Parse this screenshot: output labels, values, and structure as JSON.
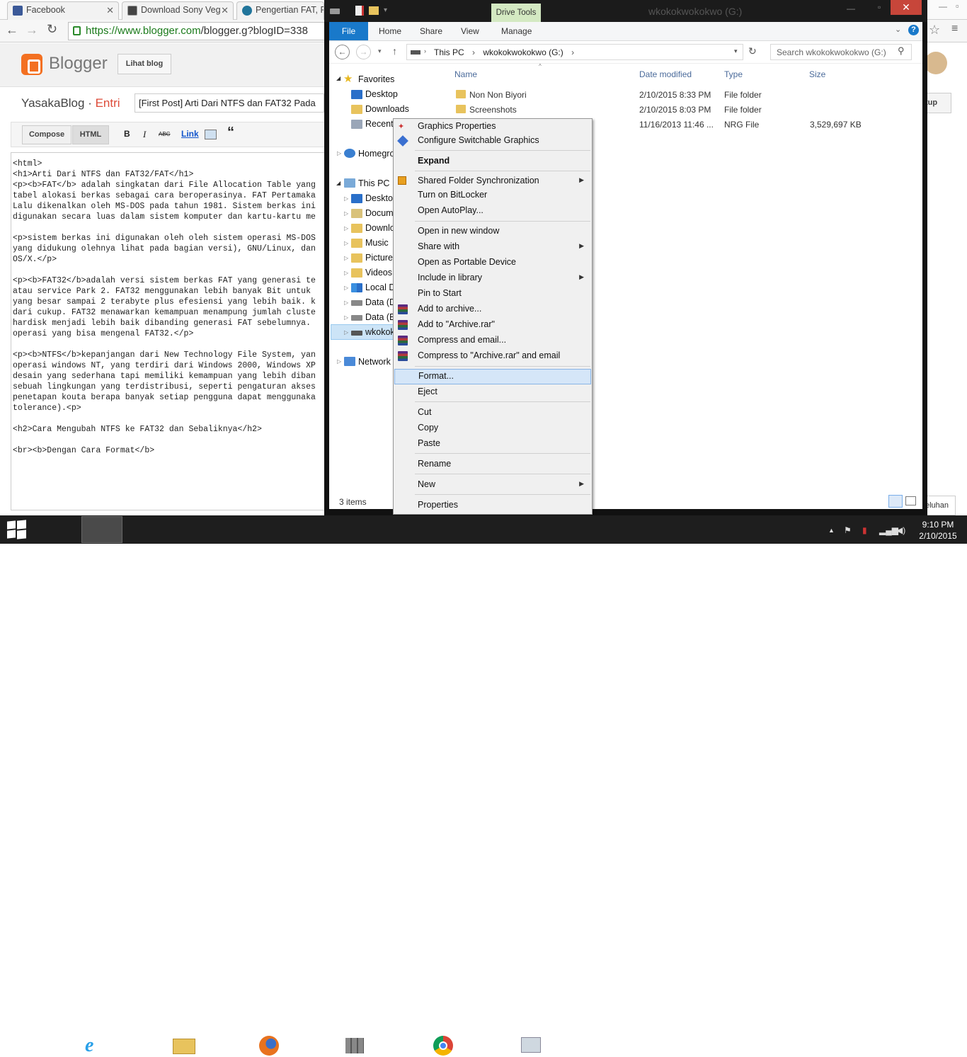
{
  "chrome": {
    "tabs": [
      {
        "label": "Facebook",
        "icon": "facebook-icon",
        "color": "#3b5998"
      },
      {
        "label": "Download Sony Veg",
        "icon": "film-icon",
        "color": "#444444"
      },
      {
        "label": "Pengertian FAT, F",
        "icon": "wordpress-icon",
        "color": "#21759b"
      }
    ],
    "url_https": "https://www.blogger.com",
    "url_rest": "/blogger.g?blogID=338"
  },
  "blogger": {
    "brand": "Blogger",
    "view_blog": "Lihat blog",
    "blog_name": "YasakaBlog",
    "separator": " · ",
    "section": "Entri",
    "post_title": "[First Post] Arti Dari NTFS dan FAT32 Pada",
    "compose": "Compose",
    "html": "HTML",
    "bold": "B",
    "italic": "I",
    "strike": "ABC",
    "link": "Link",
    "quote": "“",
    "back_label": "tup",
    "help_label": "eluhan",
    "code": "<html>\n<h1>Arti Dari NTFS dan FAT32/FAT</h1>\n<p><b>FAT</b> adalah singkatan dari File Allocation Table yang\ntabel alokasi berkas sebagai cara beroperasinya. FAT Pertamaka\nLalu dikenalkan oleh MS-DOS pada tahun 1981. Sistem berkas ini\ndigunakan secara luas dalam sistem komputer dan kartu-kartu me\n\n<p>sistem berkas ini digunakan oleh oleh sistem operasi MS-DOS\nyang didukung olehnya lihat pada bagian versi), GNU/Linux, dan\nOS/X.</p>\n\n<p><b>FAT32</b>adalah versi sistem berkas FAT yang generasi te\natau service Park 2. FAT32 menggunakan lebih banyak Bit untuk\nyang besar sampai 2 terabyte plus efesiensi yang lebih baik. k\ndari cukup. FAT32 menawarkan kemampuan menampung jumlah cluste\nhardisk menjadi lebih baik dibanding generasi FAT sebelumnya.\noperasi yang bisa mengenal FAT32.</p>\n\n<p><b>NTFS</b>kepanjangan dari New Technology File System, yan\noperasi windows NT, yang terdiri dari Windows 2000, Windows XP\ndesain yang sederhana tapi memiliki kemampuan yang lebih diban\nsebuah lingkungan yang terdistribusi, seperti pengaturan akses\npenetapan kouta berapa banyak setiap pengguna dapat menggunaka\ntolerance).<p>\n\n<h2>Cara Mengubah NTFS ke FAT32 dan Sebaliknya</h2>\n\n<br><b>Dengan Cara Format</b>"
  },
  "explorer": {
    "window_title": "wkokokwokokwo (G:)",
    "drive_tools": "Drive Tools",
    "ribbon_tabs": [
      "File",
      "Home",
      "Share",
      "View",
      "Manage"
    ],
    "breadcrumb": [
      "This PC",
      "wkokokwokokwo (G:)"
    ],
    "search_placeholder": "Search wkokokwokokwo (G:)",
    "nav": {
      "favorites": "Favorites",
      "desktop": "Desktop",
      "downloads": "Downloads",
      "recent": "Recent",
      "homegroup": "Homegro",
      "thispc": "This PC",
      "pc_desktop": "Desktop",
      "documents": "Docum",
      "pc_downloads": "Downlo",
      "music": "Music",
      "pictures": "Pictures",
      "videos": "Videos",
      "localdisk": "Local D",
      "data_d": "Data (D",
      "data_e": "Data (E:",
      "drive_g": "wkokok",
      "network": "Network"
    },
    "columns": [
      "Name",
      "Date modified",
      "Type",
      "Size"
    ],
    "files": [
      {
        "name": "Non Non Biyori",
        "date": "2/10/2015 8:33 PM",
        "type": "File folder",
        "size": ""
      },
      {
        "name": "Screenshots",
        "date": "2/10/2015 8:03 PM",
        "type": "File folder",
        "size": ""
      },
      {
        "name": "",
        "date": "11/16/2013 11:46 ...",
        "type": "NRG File",
        "size": "3,529,697 KB"
      }
    ],
    "status": "3 items"
  },
  "context_menu": {
    "graphics_properties": "Graphics Properties",
    "switchable_graphics": "Configure Switchable Graphics",
    "expand": "Expand",
    "shared_sync": "Shared Folder Synchronization",
    "bitlocker": "Turn on BitLocker",
    "autoplay": "Open AutoPlay...",
    "new_window": "Open in new window",
    "share_with": "Share with",
    "portable": "Open as Portable Device",
    "library": "Include in library",
    "pin_start": "Pin to Start",
    "add_archive": "Add to archive...",
    "add_rar": "Add to \"Archive.rar\"",
    "compress_email": "Compress and email...",
    "compress_rar_email": "Compress to \"Archive.rar\" and email",
    "format": "Format...",
    "eject": "Eject",
    "cut": "Cut",
    "copy": "Copy",
    "paste": "Paste",
    "rename": "Rename",
    "new": "New",
    "properties": "Properties"
  },
  "taskbar": {
    "time": "9:10 PM",
    "date": "2/10/2015"
  }
}
